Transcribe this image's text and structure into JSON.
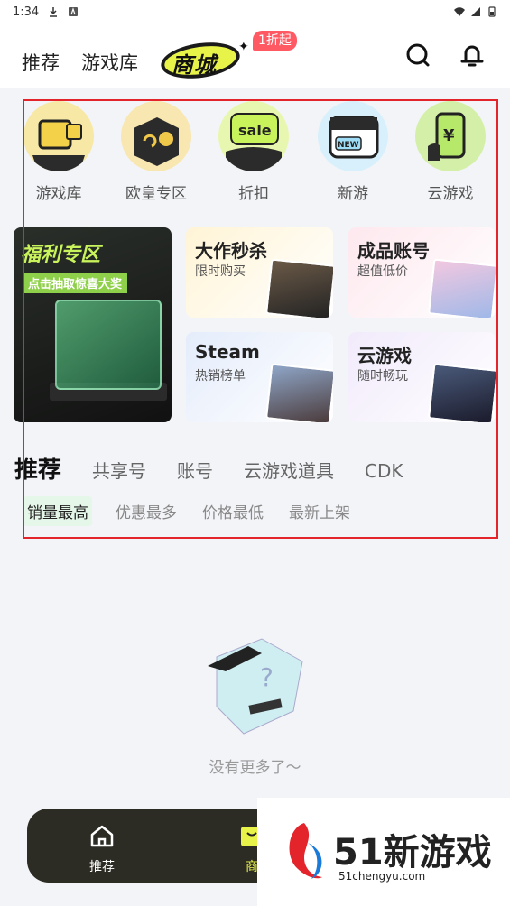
{
  "status_bar": {
    "time": "1:34"
  },
  "header": {
    "tabs": [
      "推荐",
      "游戏库"
    ],
    "logo_text": "商城",
    "badge": "1折起"
  },
  "categories": [
    {
      "label": "游戏库",
      "icon": "game-library-icon",
      "color": "#f3d24a"
    },
    {
      "label": "欧皇专区",
      "icon": "lucky-zone-icon",
      "color": "#f0c84a"
    },
    {
      "label": "折扣",
      "icon": "sale-icon",
      "color": "#c8f35a"
    },
    {
      "label": "新游",
      "icon": "new-game-icon",
      "color": "#9fdcf5"
    },
    {
      "label": "云游戏",
      "icon": "cloud-game-icon",
      "color": "#b6e86a"
    }
  ],
  "promo": {
    "title": "福利专区",
    "subtitle": "点击抽取惊喜大奖"
  },
  "tiles": [
    {
      "title": "大作秒杀",
      "subtitle": "限时购买",
      "bg": "#fff6dc",
      "art": "#5a4a3a"
    },
    {
      "title": "成品账号",
      "subtitle": "超值低价",
      "bg": "#fdeef2",
      "art": "#c9a6c8"
    },
    {
      "title": "Steam",
      "subtitle": "热销榜单",
      "bg": "#e7eefb",
      "art": "#7a8aa6"
    },
    {
      "title": "云游戏",
      "subtitle": "随时畅玩",
      "bg": "#f4eefb",
      "art": "#3a4a6a"
    }
  ],
  "subnav": [
    "推荐",
    "共享号",
    "账号",
    "云游戏道具",
    "CDK"
  ],
  "filters": [
    "销量最高",
    "优惠最多",
    "价格最低",
    "最新上架"
  ],
  "empty_text": "没有更多了～",
  "tabbar": {
    "items": [
      "推荐",
      "商"
    ]
  },
  "watermark": {
    "text": "51新游戏",
    "url": "51chengyu.com"
  }
}
